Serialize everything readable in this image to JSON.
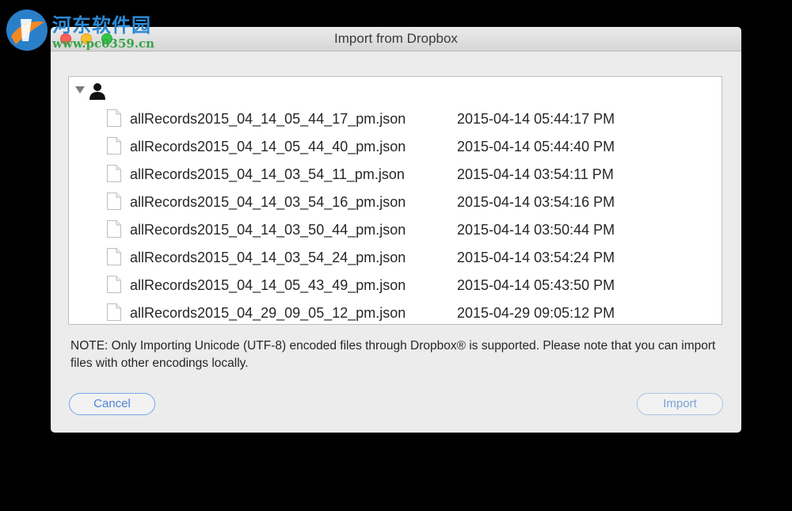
{
  "watermark": {
    "title": "河东软件园",
    "url": "www.pc0359.cn"
  },
  "window": {
    "title": "Import from Dropbox"
  },
  "tree": {
    "root_icon": "user-icon",
    "files": [
      {
        "name": "allRecords2015_04_14_05_44_17_pm.json",
        "date": "2015-04-14 05:44:17 PM"
      },
      {
        "name": "allRecords2015_04_14_05_44_40_pm.json",
        "date": "2015-04-14 05:44:40 PM"
      },
      {
        "name": "allRecords2015_04_14_03_54_11_pm.json",
        "date": "2015-04-14 03:54:11 PM"
      },
      {
        "name": "allRecords2015_04_14_03_54_16_pm.json",
        "date": "2015-04-14 03:54:16 PM"
      },
      {
        "name": "allRecords2015_04_14_03_50_44_pm.json",
        "date": "2015-04-14 03:50:44 PM"
      },
      {
        "name": "allRecords2015_04_14_03_54_24_pm.json",
        "date": "2015-04-14 03:54:24 PM"
      },
      {
        "name": "allRecords2015_04_14_05_43_49_pm.json",
        "date": "2015-04-14 05:43:50 PM"
      },
      {
        "name": "allRecords2015_04_29_09_05_12_pm.json",
        "date": "2015-04-29 09:05:12 PM"
      }
    ]
  },
  "note": "NOTE: Only Importing Unicode (UTF-8) encoded files through Dropbox® is supported. Please note that you can import files with other encodings locally.",
  "buttons": {
    "cancel": "Cancel",
    "import": "Import"
  },
  "colors": {
    "accent": "#4c86d8",
    "window_bg": "#ececec",
    "close": "#fc5f57",
    "minimize": "#fdbc2e",
    "zoom": "#33c748"
  }
}
